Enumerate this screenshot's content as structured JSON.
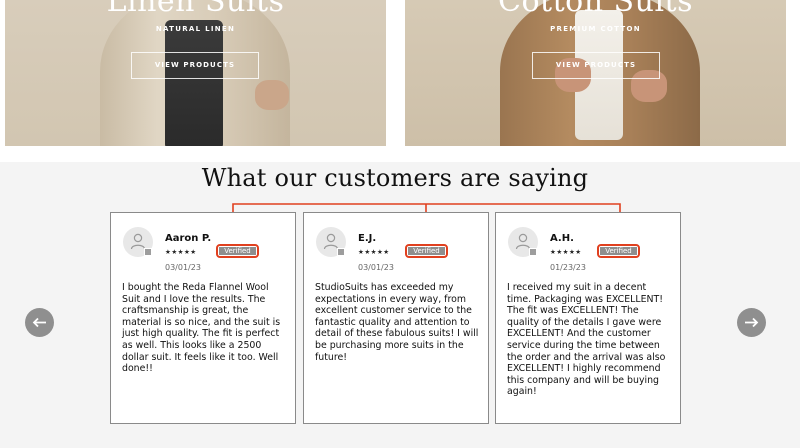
{
  "tiles": [
    {
      "title": "Linen Suits",
      "subtitle": "NATURAL LINEN",
      "button": "VIEW PRODUCTS"
    },
    {
      "title": "Cotton Suits",
      "subtitle": "PREMIUM COTTON",
      "button": "VIEW PRODUCTS"
    }
  ],
  "testimonials": {
    "heading": "What our customers are saying",
    "badge": "Verified",
    "stars": "★★★★★",
    "reviews": [
      {
        "name": "Aaron P.",
        "date": "03/01/23",
        "text": "I bought the Reda Flannel Wool Suit and I love the results. The craftsmanship is great, the material is so nice, and the suit is just high quality. The fit is perfect as well. This looks like a 2500 dollar suit. It feels like it too. Well done!!"
      },
      {
        "name": "E.J.",
        "date": "03/01/23",
        "text": "StudioSuits has exceeded my expectations in every way, from excellent customer service to the fantastic quality and attention to detail of these fabulous suits! I will be purchasing more suits in the future!"
      },
      {
        "name": "A.H.",
        "date": "01/23/23",
        "text": "I received my suit in a decent time. Packaging was EXCELLENT! The fit was EXCELLENT! The quality of the details I gave were EXCELLENT! And the customer service during the time between the order and the arrival was also EXCELLENT! I highly recommend this company and will be buying again!"
      }
    ]
  },
  "colors": {
    "annotation": "#e0401f",
    "badge_bg": "#8e8e8e",
    "nav_bg": "#8f8f8f"
  },
  "icons": {
    "prev": "arrow-left-icon",
    "next": "arrow-right-icon",
    "avatar": "user-icon"
  }
}
